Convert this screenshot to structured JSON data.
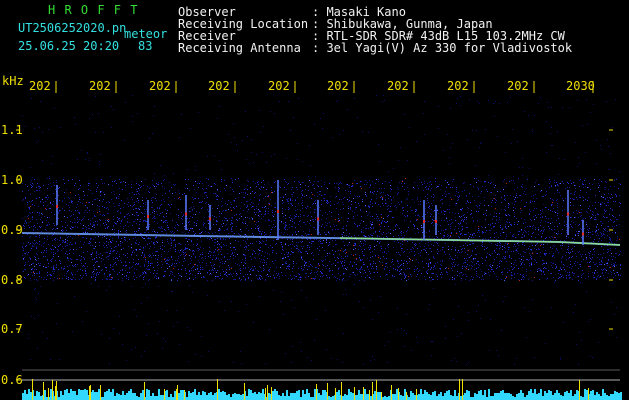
{
  "header": {
    "app_name": "H R O F F T",
    "file_name": "UT2506252020.pn",
    "mode": "meteor",
    "datetime": "25.06.25 20:20",
    "count": "83",
    "labels": {
      "observer": "Observer",
      "location": "Receiving Location",
      "receiver": "Receiver",
      "antenna": "Receiving Antenna"
    },
    "values": {
      "observer": ": Masaki Kano",
      "location": ": Shibukawa, Gunma, Japan",
      "receiver": ": RTL-SDR SDR# 43dB L15 103.2MHz CW",
      "antenna": ": 3el Yagi(V) Az 330 for Vladivostok"
    }
  },
  "axis": {
    "unit": "kHz",
    "y_ticks": [
      "1.1",
      "1.0",
      "0.9",
      "0.8",
      "0.7",
      "0.6"
    ],
    "time_ticks": [
      "202",
      "202",
      "202",
      "202",
      "202",
      "202",
      "202",
      "202",
      "202",
      "2030"
    ]
  },
  "colors": {
    "background": "#000000",
    "header_green": "#33dd33",
    "header_cyan": "#33e0e0",
    "axis_yellow": "#f0e000",
    "signal_blue": "#2030d0",
    "carrier_green": "#9cff70",
    "baseline_cyan": "#33d8ff"
  }
}
